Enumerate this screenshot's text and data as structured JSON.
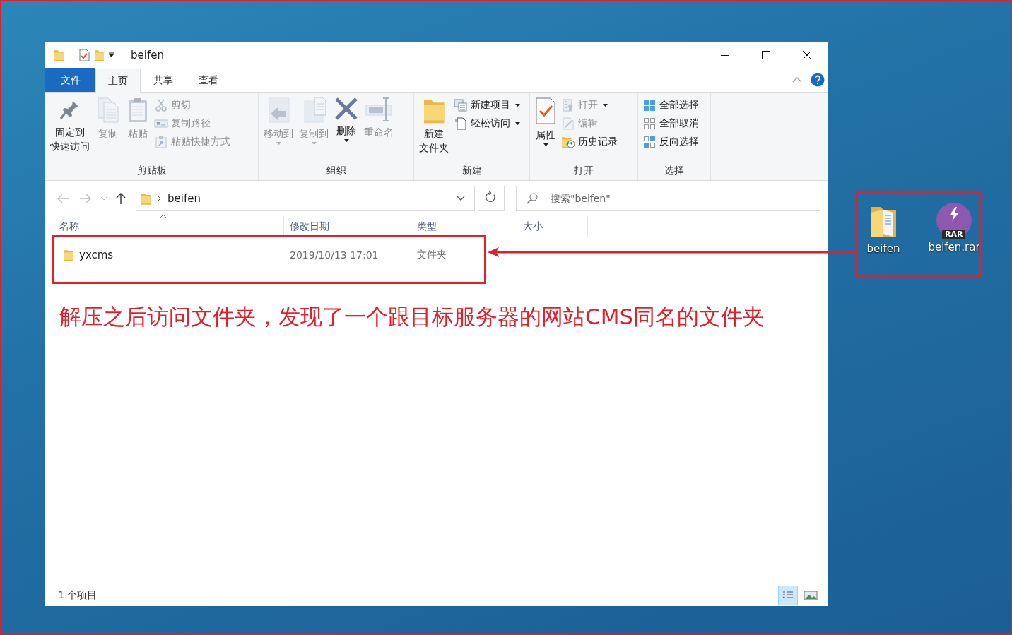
{
  "window": {
    "title": "beifen"
  },
  "ribbon_tabs": [
    {
      "label": "文件",
      "kind": "file",
      "selected": false
    },
    {
      "label": "主页",
      "kind": "tab",
      "selected": true
    },
    {
      "label": "共享",
      "kind": "tab",
      "selected": false
    },
    {
      "label": "查看",
      "kind": "tab",
      "selected": false
    }
  ],
  "ribbon_groups": [
    {
      "label": "剪贴板",
      "columns": [
        {
          "kind": "large",
          "label": [
            "固定到",
            "快速访问"
          ],
          "disabled": false,
          "dropdown": false
        },
        {
          "kind": "large",
          "label": [
            "复制"
          ],
          "disabled": true,
          "dropdown": false
        },
        {
          "kind": "large",
          "label": [
            "粘贴"
          ],
          "disabled": true,
          "dropdown": false
        },
        {
          "kind": "stack",
          "items": [
            {
              "label": "剪切",
              "disabled": true,
              "dropdown": false
            },
            {
              "label": "复制路径",
              "disabled": true,
              "dropdown": false
            },
            {
              "label": "粘贴快捷方式",
              "disabled": true,
              "dropdown": false
            }
          ]
        }
      ]
    },
    {
      "label": "组织",
      "columns": [
        {
          "kind": "large",
          "label": [
            "移动到"
          ],
          "disabled": true,
          "dropdown": true
        },
        {
          "kind": "large",
          "label": [
            "复制到"
          ],
          "disabled": true,
          "dropdown": true
        },
        {
          "kind": "large",
          "label": [
            "删除"
          ],
          "disabled": false,
          "dropdown": true
        },
        {
          "kind": "large",
          "label": [
            "重命名"
          ],
          "disabled": true,
          "dropdown": false
        }
      ]
    },
    {
      "label": "新建",
      "columns": [
        {
          "kind": "large",
          "label": [
            "新建",
            "文件夹"
          ],
          "disabled": false,
          "dropdown": false
        },
        {
          "kind": "stack",
          "items": [
            {
              "label": "新建项目",
              "disabled": false,
              "dropdown": true
            },
            {
              "label": "轻松访问",
              "disabled": false,
              "dropdown": true
            }
          ]
        }
      ]
    },
    {
      "label": "打开",
      "columns": [
        {
          "kind": "large",
          "label": [
            "属性"
          ],
          "disabled": false,
          "dropdown": true
        },
        {
          "kind": "stack",
          "items": [
            {
              "label": "打开",
              "disabled": true,
              "dropdown": true
            },
            {
              "label": "编辑",
              "disabled": true,
              "dropdown": false
            },
            {
              "label": "历史记录",
              "disabled": false,
              "dropdown": false
            }
          ]
        }
      ]
    },
    {
      "label": "选择",
      "columns": [
        {
          "kind": "stack",
          "items": [
            {
              "label": "全部选择",
              "disabled": false,
              "dropdown": false
            },
            {
              "label": "全部取消",
              "disabled": false,
              "dropdown": false
            },
            {
              "label": "反向选择",
              "disabled": false,
              "dropdown": false
            }
          ]
        }
      ]
    }
  ],
  "address": {
    "path": [
      {
        "label": "beifen"
      }
    ]
  },
  "search": {
    "placeholder": "搜索\"beifen\""
  },
  "file_list": {
    "columns": [
      {
        "label": "名称",
        "sorted": true
      },
      {
        "label": "修改日期",
        "sorted": false
      },
      {
        "label": "类型",
        "sorted": false
      },
      {
        "label": "大小",
        "sorted": false
      }
    ],
    "rows": [
      {
        "name": "yxcms",
        "modified": "2019/10/13 17:01",
        "type": "文件夹",
        "selected": false
      }
    ]
  },
  "status_bar": {
    "count": "1 个项目",
    "views": [
      {
        "kind": "details",
        "selected": true
      },
      {
        "kind": "large-icons",
        "selected": false
      }
    ]
  },
  "desktop_icons": [
    {
      "label": "beifen",
      "kind": "folder"
    },
    {
      "label": "beifen.rar",
      "kind": "rar",
      "badge": "RAR"
    }
  ],
  "annotation": {
    "caption": "解压之后访问文件夹，发现了一个跟目标服务器的网站CMS同名的文件夹"
  }
}
